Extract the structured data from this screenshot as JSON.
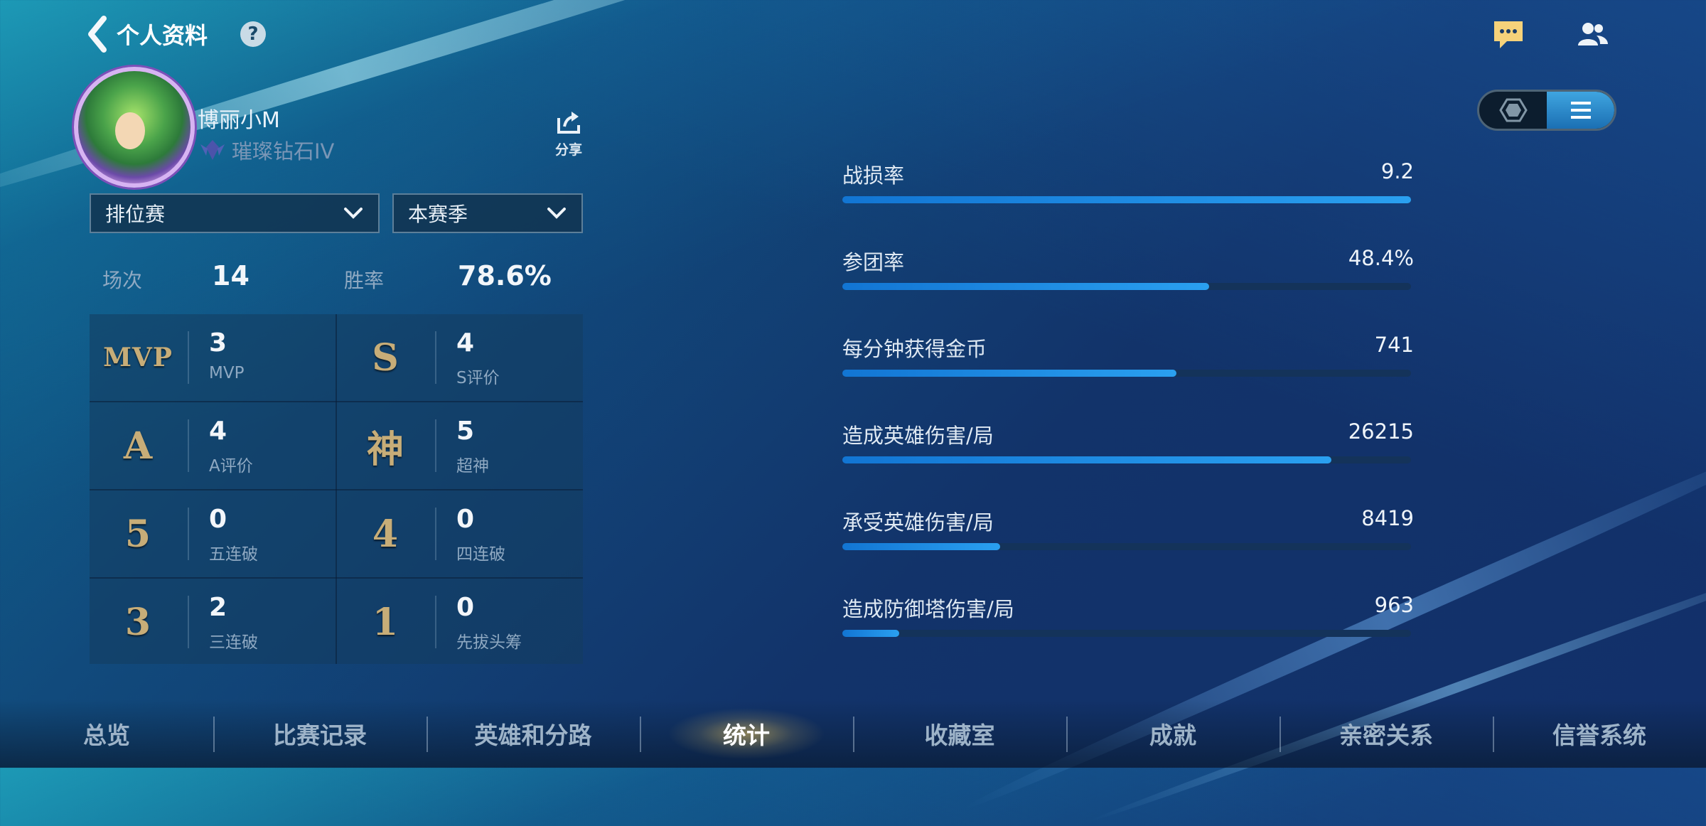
{
  "header": {
    "title": "个人资料",
    "help_icon": "question-mark-icon",
    "chat_icon": "chat-icon",
    "friends_icon": "friends-icon"
  },
  "profile": {
    "username": "博丽小M",
    "rank": "璀璨钻石IV",
    "share_label": "分享"
  },
  "filters": {
    "mode": "排位赛",
    "season": "本赛季"
  },
  "summary": {
    "games_label": "场次",
    "games_value": "14",
    "winrate_label": "胜率",
    "winrate_value": "78.6%"
  },
  "stats": [
    {
      "glyph": "MVP",
      "value": "3",
      "name": "MVP"
    },
    {
      "glyph": "S",
      "value": "4",
      "name": "S评价"
    },
    {
      "glyph": "A",
      "value": "4",
      "name": "A评价"
    },
    {
      "glyph": "神",
      "value": "5",
      "name": "超神"
    },
    {
      "glyph": "5",
      "value": "0",
      "name": "五连破"
    },
    {
      "glyph": "4",
      "value": "0",
      "name": "四连破"
    },
    {
      "glyph": "3",
      "value": "2",
      "name": "三连破"
    },
    {
      "glyph": "1",
      "value": "0",
      "name": "先拔头筹"
    }
  ],
  "metrics": [
    {
      "label": "战损率",
      "value": "9.2",
      "fill": 1.0
    },
    {
      "label": "参团率",
      "value": "48.4%",
      "fill": 0.645
    },
    {
      "label": "每分钟获得金币",
      "value": "741",
      "fill": 0.588
    },
    {
      "label": "造成英雄伤害/局",
      "value": "26215",
      "fill": 0.86
    },
    {
      "label": "承受英雄伤害/局",
      "value": "8419",
      "fill": 0.277
    },
    {
      "label": "造成防御塔伤害/局",
      "value": "963",
      "fill": 0.1
    }
  ],
  "view_toggle": {
    "options": [
      "hexagon-icon",
      "list-icon"
    ],
    "active": "list-icon"
  },
  "tabs": [
    {
      "label": "总览",
      "active": false
    },
    {
      "label": "比赛记录",
      "active": false
    },
    {
      "label": "英雄和分路",
      "active": false
    },
    {
      "label": "统计",
      "active": true
    },
    {
      "label": "收藏室",
      "active": false
    },
    {
      "label": "成就",
      "active": false
    },
    {
      "label": "亲密关系",
      "active": false
    },
    {
      "label": "信誉系统",
      "active": false
    }
  ],
  "colors": {
    "accent_gold": "#c7ad78",
    "bar_blue": "#1a86e0",
    "track": "#14335a"
  }
}
